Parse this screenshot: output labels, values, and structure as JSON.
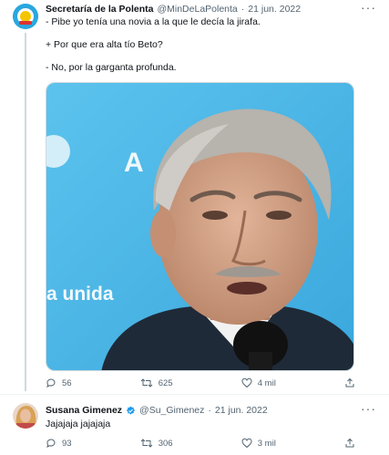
{
  "tweet1": {
    "author_name": "Secretaría de la Polenta",
    "handle": "@MinDeLaPolenta",
    "separator": "·",
    "date": "21 jun. 2022",
    "lines": [
      "- Pibe yo tenía una novia a la que le decía la jirafa.",
      "+ Por que era alta tío Beto?",
      "- No, por la garganta profunda."
    ],
    "image_overlay_text": [
      "A",
      "a unida"
    ],
    "stats": {
      "replies": "56",
      "retweets": "625",
      "likes": "4 mil"
    }
  },
  "tweet2": {
    "author_name": "Susana Gimenez",
    "handle": "@Su_Gimenez",
    "separator": "·",
    "date": "21 jun. 2022",
    "text": "Jajajaja jajajaja",
    "stats": {
      "replies": "93",
      "retweets": "306",
      "likes": "3 mil"
    }
  },
  "colors": {
    "text": "#0f1419",
    "secondary": "#536471",
    "verified": "#1d9bf0",
    "border": "#cfd9de",
    "image_bg": "#48b6e6"
  },
  "icons": [
    "more-icon",
    "reply-icon",
    "retweet-icon",
    "like-icon",
    "share-icon",
    "verified-badge-icon"
  ]
}
